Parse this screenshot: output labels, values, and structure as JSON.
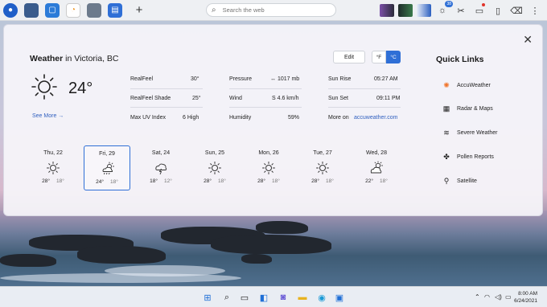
{
  "browser": {
    "search_placeholder": "Search the web",
    "new_tab_label": "+",
    "notification_count": "38"
  },
  "weather": {
    "title": "Weather",
    "location": "in Victoria, BC",
    "edit_label": "Edit",
    "unit_f": "°F",
    "unit_c": "°C",
    "current_temp": "24°",
    "see_more": "See More →",
    "details": {
      "realfeel_label": "RealFeel",
      "realfeel_value": "30°",
      "realfeel_shade_label": "RealFeel Shade",
      "realfeel_shade_value": "25°",
      "uv_label": "Max UV Index",
      "uv_value": "6 High",
      "pressure_label": "Pressure",
      "pressure_value": "↔ 1017 mb",
      "wind_label": "Wind",
      "wind_value": "S 4.6 km/h",
      "humidity_label": "Humidity",
      "humidity_value": "59%",
      "sunrise_label": "Sun Rise",
      "sunrise_value": "05:27 AM",
      "sunset_label": "Sun Set",
      "sunset_value": "09:11 PM",
      "more_on_label": "More on",
      "more_on_link": "accuweather.com"
    },
    "forecast": [
      {
        "day": "Thu, 22",
        "high": "28°",
        "low": "18°",
        "icon": "sun-icon"
      },
      {
        "day": "Fri, 29",
        "high": "24°",
        "low": "18°",
        "icon": "storm-sun-icon"
      },
      {
        "day": "Sat, 24",
        "high": "18°",
        "low": "12°",
        "icon": "thunder-cloud-icon"
      },
      {
        "day": "Sun, 25",
        "high": "28°",
        "low": "18°",
        "icon": "sun-icon"
      },
      {
        "day": "Mon, 26",
        "high": "28°",
        "low": "18°",
        "icon": "sun-icon"
      },
      {
        "day": "Tue, 27",
        "high": "28°",
        "low": "18°",
        "icon": "sun-icon"
      },
      {
        "day": "Wed, 28",
        "high": "22°",
        "low": "18°",
        "icon": "partly-cloudy-icon"
      }
    ]
  },
  "quick_links": {
    "title": "Quick Links",
    "items": [
      {
        "label": "AccuWeather",
        "icon": "accuweather-icon"
      },
      {
        "label": "Radar & Maps",
        "icon": "map-icon"
      },
      {
        "label": "Severe Weather",
        "icon": "wind-icon"
      },
      {
        "label": "Pollen Reports",
        "icon": "flower-icon"
      },
      {
        "label": "Satellite",
        "icon": "satellite-icon"
      }
    ]
  },
  "taskbar": {
    "time": "8:00 AM",
    "date": "6/24/2021"
  },
  "colors": {
    "accent": "#2f6fd6",
    "sun_orange": "#f0742a"
  }
}
